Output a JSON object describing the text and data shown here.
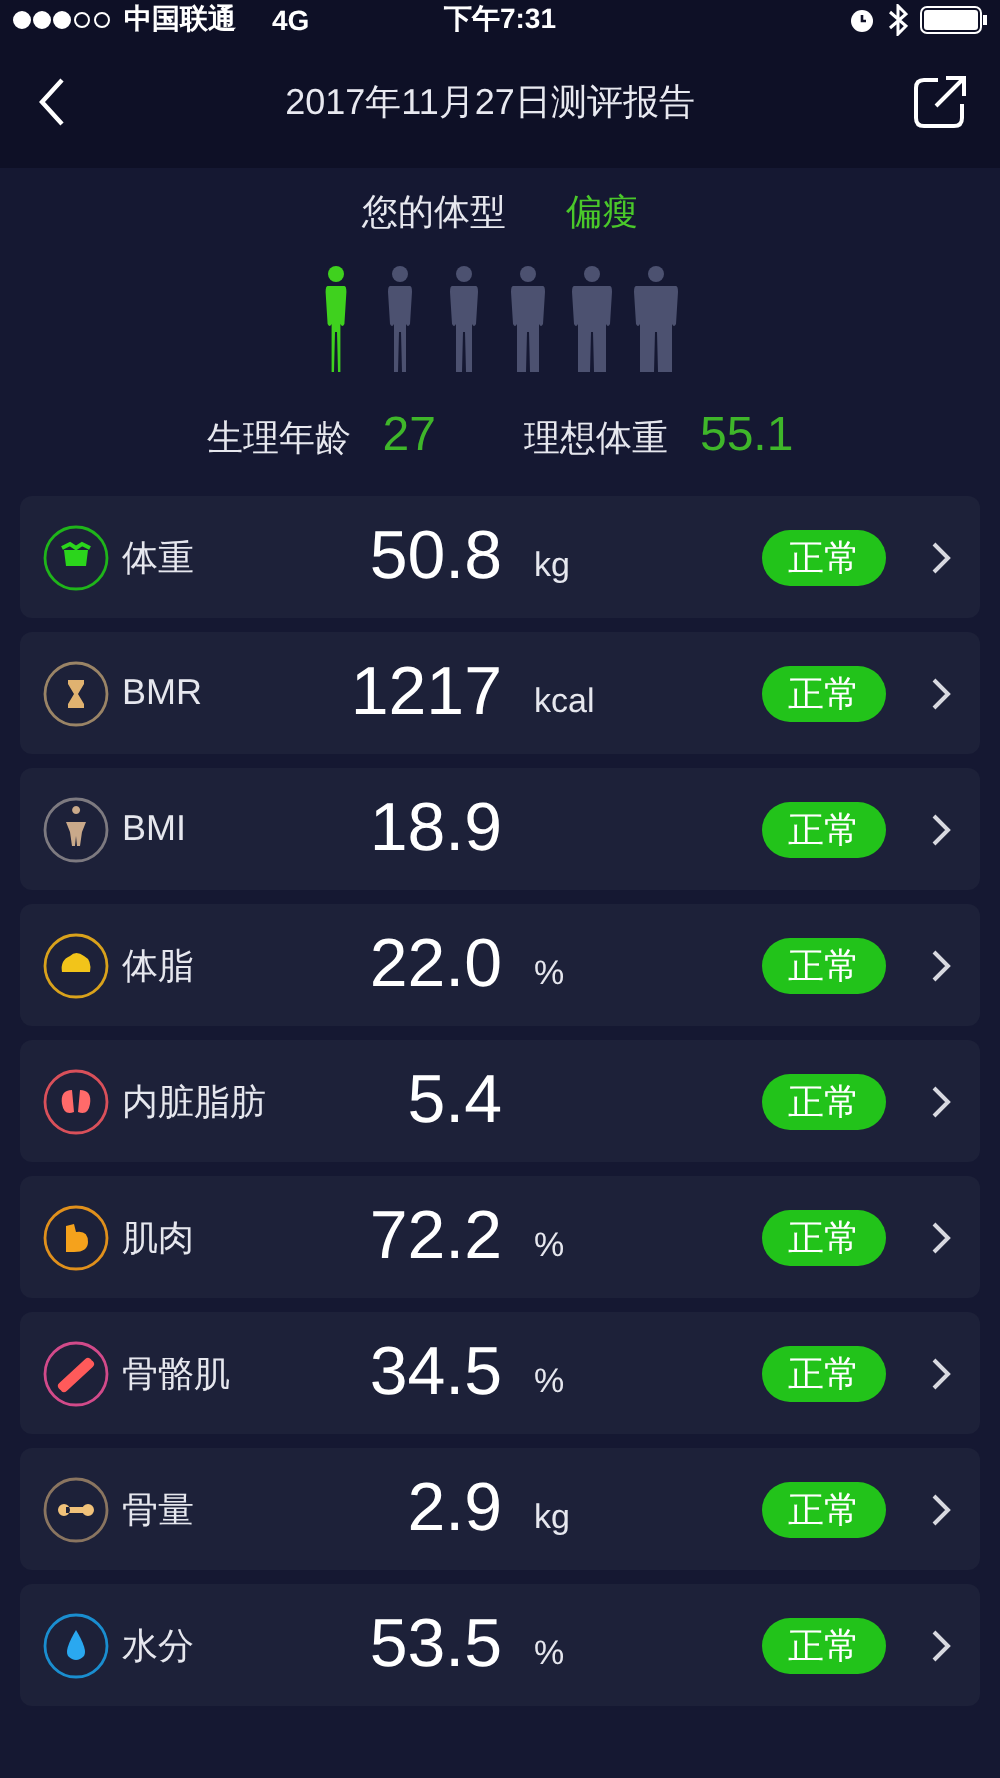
{
  "status_bar": {
    "carrier": "中国联通",
    "network": "4G",
    "time": "下午7:31"
  },
  "nav": {
    "title": "2017年11月27日测评报告"
  },
  "body_type": {
    "label": "您的体型",
    "value": "偏瘦",
    "figures": [
      {
        "selected": true
      },
      {
        "selected": false
      },
      {
        "selected": false
      },
      {
        "selected": false
      },
      {
        "selected": false
      },
      {
        "selected": false
      }
    ]
  },
  "stats": [
    {
      "label": "生理年龄",
      "value": "27"
    },
    {
      "label": "理想体重",
      "value": "55.1"
    }
  ],
  "metrics": [
    {
      "name": "体重",
      "value": "50.8",
      "unit": "kg",
      "status": "正常",
      "color": "#1fb51a",
      "kind": "scale"
    },
    {
      "name": "BMR",
      "value": "1217",
      "unit": "kcal",
      "status": "正常",
      "color": "#9a8466",
      "kind": "hourglass"
    },
    {
      "name": "BMI",
      "value": "18.9",
      "status": "正常",
      "color": "#7d7a80",
      "kind": "figure"
    },
    {
      "name": "体脂",
      "value": "22.0",
      "unit": "%",
      "status": "正常",
      "color": "#d9a21c",
      "kind": "fat"
    },
    {
      "name": "内脏脂肪",
      "value": "5.4",
      "status": "正常",
      "color": "#d9505a",
      "kind": "organ"
    },
    {
      "name": "肌肉",
      "value": "72.2",
      "unit": "%",
      "status": "正常",
      "color": "#e0901c",
      "kind": "muscle"
    },
    {
      "name": "骨骼肌",
      "value": "34.5",
      "unit": "%",
      "status": "正常",
      "color": "#d24a8a",
      "kind": "bonemuscle"
    },
    {
      "name": "骨量",
      "value": "2.9",
      "unit": "kg",
      "status": "正常",
      "color": "#8a7560",
      "kind": "bone"
    },
    {
      "name": "水分",
      "value": "53.5",
      "unit": "%",
      "status": "正常",
      "color": "#1a8ed0",
      "kind": "water"
    }
  ]
}
